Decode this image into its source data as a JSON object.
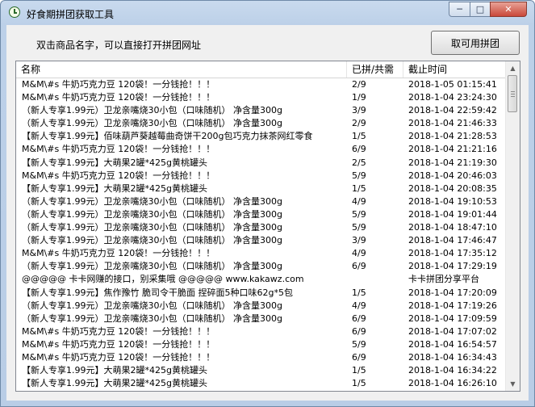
{
  "window": {
    "title": "好食期拼团获取工具",
    "icon": "clock-icon"
  },
  "controls": {
    "minimize": "─",
    "maximize": "□",
    "close": "✕"
  },
  "instruction": "双击商品名字，可以直接打开拼团网址",
  "button": {
    "label": "取可用拼团"
  },
  "columns": [
    "名称",
    "已拼/共需",
    "截止时间"
  ],
  "rows": [
    {
      "name": "M&M\\#s 牛奶巧克力豆 120袋！一分钱抢！！！",
      "count": "2/9",
      "deadline": "2018-1-05 01:15:41"
    },
    {
      "name": "M&M\\#s 牛奶巧克力豆 120袋！一分钱抢！！！",
      "count": "1/9",
      "deadline": "2018-1-04 23:24:30"
    },
    {
      "name": "（新人专享1.99元）卫龙亲嘴烧30小包（口味随机） 净含量300g",
      "count": "3/9",
      "deadline": "2018-1-04 22:59:42"
    },
    {
      "name": "（新人专享1.99元）卫龙亲嘴烧30小包（口味随机） 净含量300g",
      "count": "2/9",
      "deadline": "2018-1-04 21:46:33"
    },
    {
      "name": "【新人专享1.99元】佰味葫芦葵越莓曲奇饼干200g包巧克力抹茶网红零食",
      "count": "1/5",
      "deadline": "2018-1-04 21:28:53"
    },
    {
      "name": "M&M\\#s 牛奶巧克力豆 120袋！一分钱抢！！！",
      "count": "6/9",
      "deadline": "2018-1-04 21:21:16"
    },
    {
      "name": "【新人专享1.99元】大萌果2罐*425g黄桃罐头",
      "count": "2/5",
      "deadline": "2018-1-04 21:19:30"
    },
    {
      "name": "M&M\\#s 牛奶巧克力豆 120袋！一分钱抢！！！",
      "count": "5/9",
      "deadline": "2018-1-04 20:46:03"
    },
    {
      "name": "【新人专享1.99元】大萌果2罐*425g黄桃罐头",
      "count": "1/5",
      "deadline": "2018-1-04 20:08:35"
    },
    {
      "name": "（新人专享1.99元）卫龙亲嘴烧30小包（口味随机） 净含量300g",
      "count": "4/9",
      "deadline": "2018-1-04 19:10:53"
    },
    {
      "name": "（新人专享1.99元）卫龙亲嘴烧30小包（口味随机） 净含量300g",
      "count": "5/9",
      "deadline": "2018-1-04 19:01:44"
    },
    {
      "name": "（新人专享1.99元）卫龙亲嘴烧30小包（口味随机） 净含量300g",
      "count": "5/9",
      "deadline": "2018-1-04 18:47:10"
    },
    {
      "name": "（新人专享1.99元）卫龙亲嘴烧30小包（口味随机） 净含量300g",
      "count": "3/9",
      "deadline": "2018-1-04 17:46:47"
    },
    {
      "name": "M&M\\#s 牛奶巧克力豆 120袋！一分钱抢！！！",
      "count": "4/9",
      "deadline": "2018-1-04 17:35:12"
    },
    {
      "name": "（新人专享1.99元）卫龙亲嘴烧30小包（口味随机） 净含量300g",
      "count": "6/9",
      "deadline": "2018-1-04 17:29:19"
    },
    {
      "name": "@@@@@ 卡卡网赚的接口，别采集哦 @@@@@ www.kakawz.com",
      "count": "",
      "deadline": "卡卡拼团分享平台"
    },
    {
      "name": "【新人专享1.99元】焦作豫竹 脆司令干脆面 捏碎面5种口味62g*5包",
      "count": "1/5",
      "deadline": "2018-1-04 17:20:09"
    },
    {
      "name": "（新人专享1.99元）卫龙亲嘴烧30小包（口味随机） 净含量300g",
      "count": "4/9",
      "deadline": "2018-1-04 17:19:26"
    },
    {
      "name": "（新人专享1.99元）卫龙亲嘴烧30小包（口味随机） 净含量300g",
      "count": "6/9",
      "deadline": "2018-1-04 17:09:59"
    },
    {
      "name": "M&M\\#s 牛奶巧克力豆 120袋！一分钱抢！！！",
      "count": "6/9",
      "deadline": "2018-1-04 17:07:02"
    },
    {
      "name": "M&M\\#s 牛奶巧克力豆 120袋！一分钱抢！！！",
      "count": "5/9",
      "deadline": "2018-1-04 16:54:57"
    },
    {
      "name": "M&M\\#s 牛奶巧克力豆 120袋！一分钱抢！！！",
      "count": "6/9",
      "deadline": "2018-1-04 16:34:43"
    },
    {
      "name": "【新人专享1.99元】大萌果2罐*425g黄桃罐头",
      "count": "1/5",
      "deadline": "2018-1-04 16:34:22"
    },
    {
      "name": "【新人专享1.99元】大萌果2罐*425g黄桃罐头",
      "count": "1/5",
      "deadline": "2018-1-04 16:26:10"
    }
  ],
  "scrollbar": {
    "up": "▲",
    "down": "▼"
  }
}
